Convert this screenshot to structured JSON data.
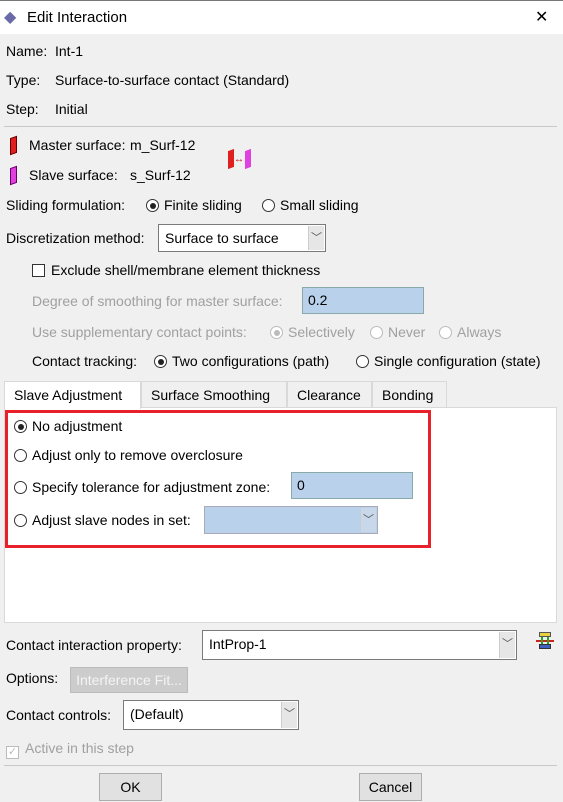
{
  "window": {
    "title": "Edit Interaction",
    "close": "✕"
  },
  "info": {
    "name_label": "Name:",
    "name": "Int-1",
    "type_label": "Type:",
    "type": "Surface-to-surface contact (Standard)",
    "step_label": "Step:",
    "step": "Initial"
  },
  "surfaces": {
    "master_label": "Master surface:",
    "master": "m_Surf-12",
    "slave_label": "Slave surface:",
    "slave": "s_Surf-12",
    "master_color": "#e02020",
    "slave_color": "#e040e0"
  },
  "sliding": {
    "label": "Sliding formulation:",
    "options": [
      "Finite sliding",
      "Small sliding"
    ],
    "selected": "Finite sliding"
  },
  "discretization": {
    "label": "Discretization method:",
    "value": "Surface to surface"
  },
  "exclude_thickness": {
    "label": "Exclude shell/membrane element thickness",
    "checked": false
  },
  "smoothing": {
    "label": "Degree of smoothing for master surface:",
    "value": "0.2"
  },
  "supplementary": {
    "label": "Use supplementary contact points:",
    "options": [
      "Selectively",
      "Never",
      "Always"
    ],
    "selected": "Selectively"
  },
  "tracking": {
    "label": "Contact tracking:",
    "options": [
      "Two configurations (path)",
      "Single configuration (state)"
    ],
    "selected": "Two configurations (path)"
  },
  "tabs": [
    {
      "label": "Slave Adjustment",
      "active": true
    },
    {
      "label": "Surface Smoothing"
    },
    {
      "label": "Clearance"
    },
    {
      "label": "Bonding"
    }
  ],
  "slave_adjustment": {
    "options": [
      "No adjustment",
      "Adjust only to remove overclosure",
      "Specify tolerance for adjustment zone:",
      "Adjust slave nodes in set:"
    ],
    "selected": "No adjustment",
    "tolerance": "0",
    "node_set": "",
    "highlight_color": "#e8202a"
  },
  "property": {
    "label": "Contact interaction property:",
    "value": "IntProp-1"
  },
  "options": {
    "label": "Options:",
    "button": "Interference Fit..."
  },
  "controls": {
    "label": "Contact controls:",
    "value": "(Default)"
  },
  "active": {
    "label": "Active in this step",
    "checked": true
  },
  "buttons": {
    "ok": "OK",
    "cancel": "Cancel"
  }
}
